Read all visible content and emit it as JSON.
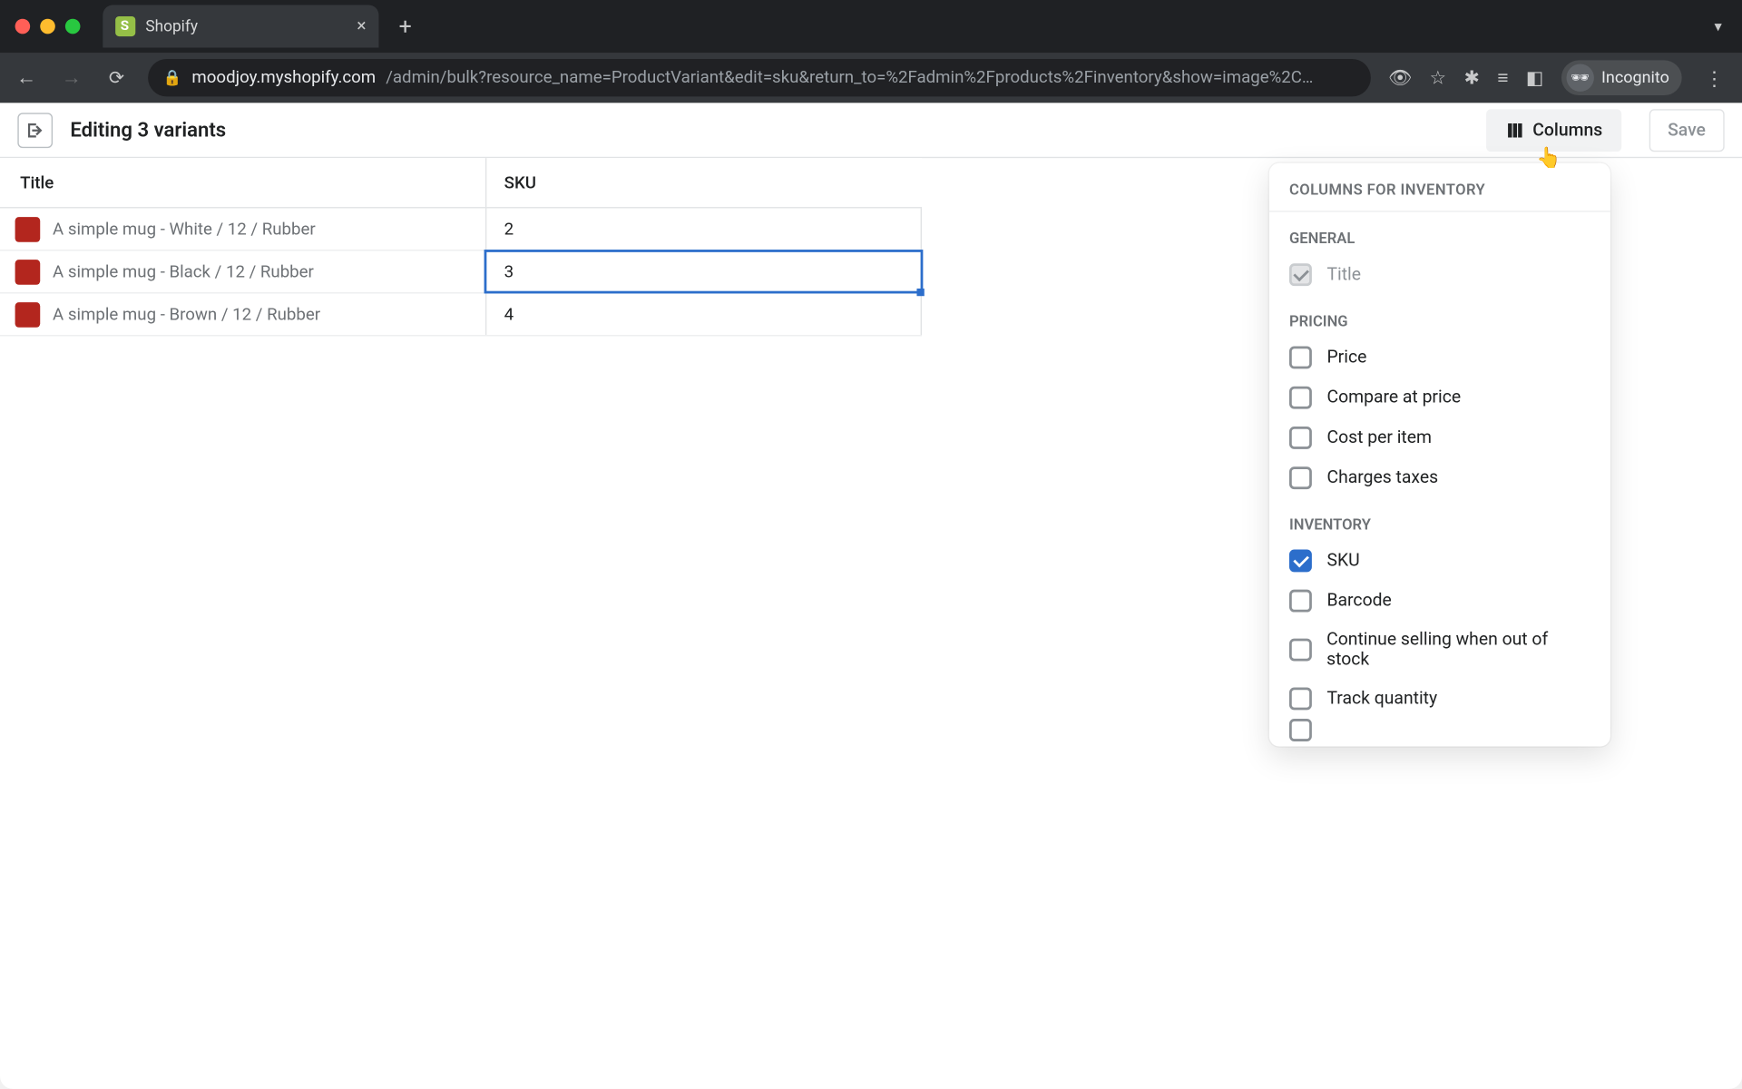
{
  "browser": {
    "tab_title": "Shopify",
    "url_host": "moodjoy.myshopify.com",
    "url_path": "/admin/bulk?resource_name=ProductVariant&edit=sku&return_to=%2Fadmin%2Fproducts%2Finventory&show=image%2C…",
    "incognito_label": "Incognito"
  },
  "header": {
    "title": "Editing 3 variants",
    "columns_button": "Columns",
    "save_button": "Save"
  },
  "table": {
    "columns": {
      "title": "Title",
      "sku": "SKU"
    },
    "rows": [
      {
        "title": "A simple mug - White / 12 / Rubber",
        "sku": "2",
        "selected": false
      },
      {
        "title": "A simple mug - Black / 12 / Rubber",
        "sku": "3",
        "selected": true
      },
      {
        "title": "A simple mug - Brown / 12 / Rubber",
        "sku": "4",
        "selected": false
      }
    ]
  },
  "columns_panel": {
    "heading": "COLUMNS FOR INVENTORY",
    "sections": [
      {
        "label": "GENERAL",
        "items": [
          {
            "label": "Title",
            "checked": true,
            "disabled": true
          }
        ]
      },
      {
        "label": "PRICING",
        "items": [
          {
            "label": "Price",
            "checked": false,
            "disabled": false
          },
          {
            "label": "Compare at price",
            "checked": false,
            "disabled": false
          },
          {
            "label": "Cost per item",
            "checked": false,
            "disabled": false
          },
          {
            "label": "Charges taxes",
            "checked": false,
            "disabled": false
          }
        ]
      },
      {
        "label": "INVENTORY",
        "items": [
          {
            "label": "SKU",
            "checked": true,
            "disabled": false
          },
          {
            "label": "Barcode",
            "checked": false,
            "disabled": false
          },
          {
            "label": "Continue selling when out of stock",
            "checked": false,
            "disabled": false
          },
          {
            "label": "Track quantity",
            "checked": false,
            "disabled": false
          }
        ]
      }
    ]
  }
}
